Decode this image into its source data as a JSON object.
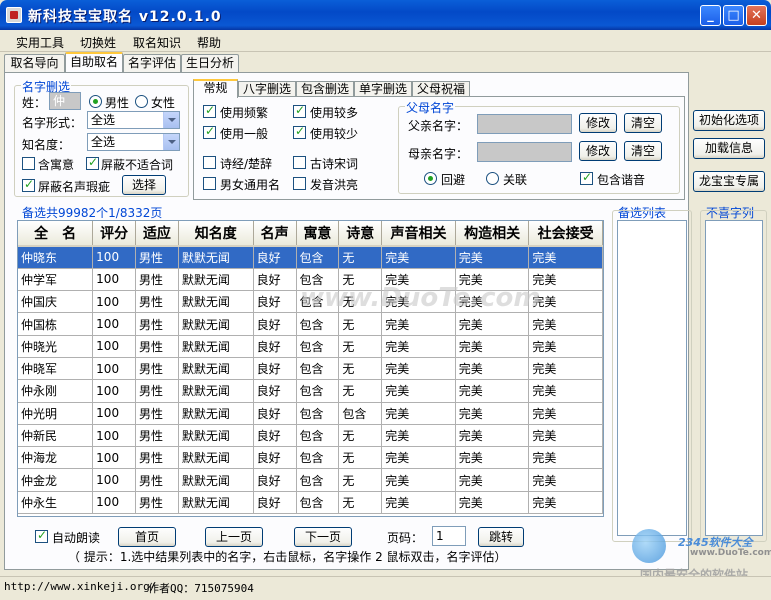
{
  "window": {
    "title": "新科技宝宝取名 v12.0.1.0",
    "minimize": "_",
    "maximize": "□",
    "close": "✕"
  },
  "menu": [
    "实用工具",
    "切换姓",
    "取名知识",
    "帮助"
  ],
  "main_tabs": [
    "取名导向",
    "自助取名",
    "名字评估",
    "生日分析"
  ],
  "filter": {
    "title": "名字删选",
    "surname_label": "姓：",
    "surname_value": "仲",
    "male_label": "男性",
    "female_label": "女性",
    "form_label": "名字形式：",
    "form_value": "全选",
    "fame_label": "知名度：",
    "fame_value": "全选",
    "meaning_label": "含寓意",
    "block_unfit_label": "屏蔽不适合词",
    "block_sound_label": "屏蔽名声瑕疵",
    "choose_button": "选择"
  },
  "inner_tabs": [
    "常规",
    "八字删选",
    "包含删选",
    "单字删选",
    "父母祝福"
  ],
  "general": {
    "freq_high": "使用频繁",
    "freq_more": "使用较多",
    "freq_normal": "使用一般",
    "freq_less": "使用较少",
    "poetry": "诗经/楚辞",
    "ancient_poem": "古诗宋词",
    "unisex": "男女通用名",
    "sound_loud": "发音洪亮"
  },
  "parents": {
    "title": "父母名字",
    "father_label": "父亲名字：",
    "mother_label": "母亲名字：",
    "modify_button": "修改",
    "clear_button": "清空",
    "avoid_label": "回避",
    "relate_label": "关联",
    "homophone_label": "包含谐音"
  },
  "side_buttons": [
    "初始化选项",
    "加载信息",
    "龙宝宝专属"
  ],
  "list": {
    "summary": "备选共99982个1/8332页",
    "columns": [
      "全　名",
      "评分",
      "适应",
      "知名度",
      "名声",
      "寓意",
      "诗意",
      "声音相关",
      "构造相关",
      "社会接受"
    ],
    "rows": [
      [
        "仲晓东",
        "100",
        "男性",
        "默默无闻",
        "良好",
        "包含",
        "无",
        "完美",
        "完美",
        "完美"
      ],
      [
        "仲学军",
        "100",
        "男性",
        "默默无闻",
        "良好",
        "包含",
        "无",
        "完美",
        "完美",
        "完美"
      ],
      [
        "仲国庆",
        "100",
        "男性",
        "默默无闻",
        "良好",
        "包含",
        "无",
        "完美",
        "完美",
        "完美"
      ],
      [
        "仲国栋",
        "100",
        "男性",
        "默默无闻",
        "良好",
        "包含",
        "无",
        "完美",
        "完美",
        "完美"
      ],
      [
        "仲晓光",
        "100",
        "男性",
        "默默无闻",
        "良好",
        "包含",
        "无",
        "完美",
        "完美",
        "完美"
      ],
      [
        "仲晓军",
        "100",
        "男性",
        "默默无闻",
        "良好",
        "包含",
        "无",
        "完美",
        "完美",
        "完美"
      ],
      [
        "仲永刚",
        "100",
        "男性",
        "默默无闻",
        "良好",
        "包含",
        "无",
        "完美",
        "完美",
        "完美"
      ],
      [
        "仲光明",
        "100",
        "男性",
        "默默无闻",
        "良好",
        "包含",
        "包含",
        "完美",
        "完美",
        "完美"
      ],
      [
        "仲新民",
        "100",
        "男性",
        "默默无闻",
        "良好",
        "包含",
        "无",
        "完美",
        "完美",
        "完美"
      ],
      [
        "仲海龙",
        "100",
        "男性",
        "默默无闻",
        "良好",
        "包含",
        "无",
        "完美",
        "完美",
        "完美"
      ],
      [
        "仲金龙",
        "100",
        "男性",
        "默默无闻",
        "良好",
        "包含",
        "无",
        "完美",
        "完美",
        "完美"
      ],
      [
        "仲永生",
        "100",
        "男性",
        "默默无闻",
        "良好",
        "包含",
        "无",
        "完美",
        "完美",
        "完美"
      ]
    ]
  },
  "candidate_list_title": "备选列表",
  "disliked_list_title": "不喜字列",
  "pager": {
    "auto_read": "自动朗读",
    "first": "首页",
    "prev": "上一页",
    "next": "下一页",
    "page_label": "页码：",
    "page_value": "1",
    "jump": "跳转",
    "hint": "（ 提示：1.选中结果列表中的名字，右击鼠标，名字操作 2 鼠标双击，名字评估）"
  },
  "status": {
    "url": "http://www.xinkeji.org/",
    "author": "作者QQ：715075904"
  },
  "watermarks": {
    "duote": "www.DuoTe.com",
    "logo_text": "2345软件大全",
    "logo_url": "www.DuoTe.com",
    "tagline": "国内最安全的软件站"
  }
}
